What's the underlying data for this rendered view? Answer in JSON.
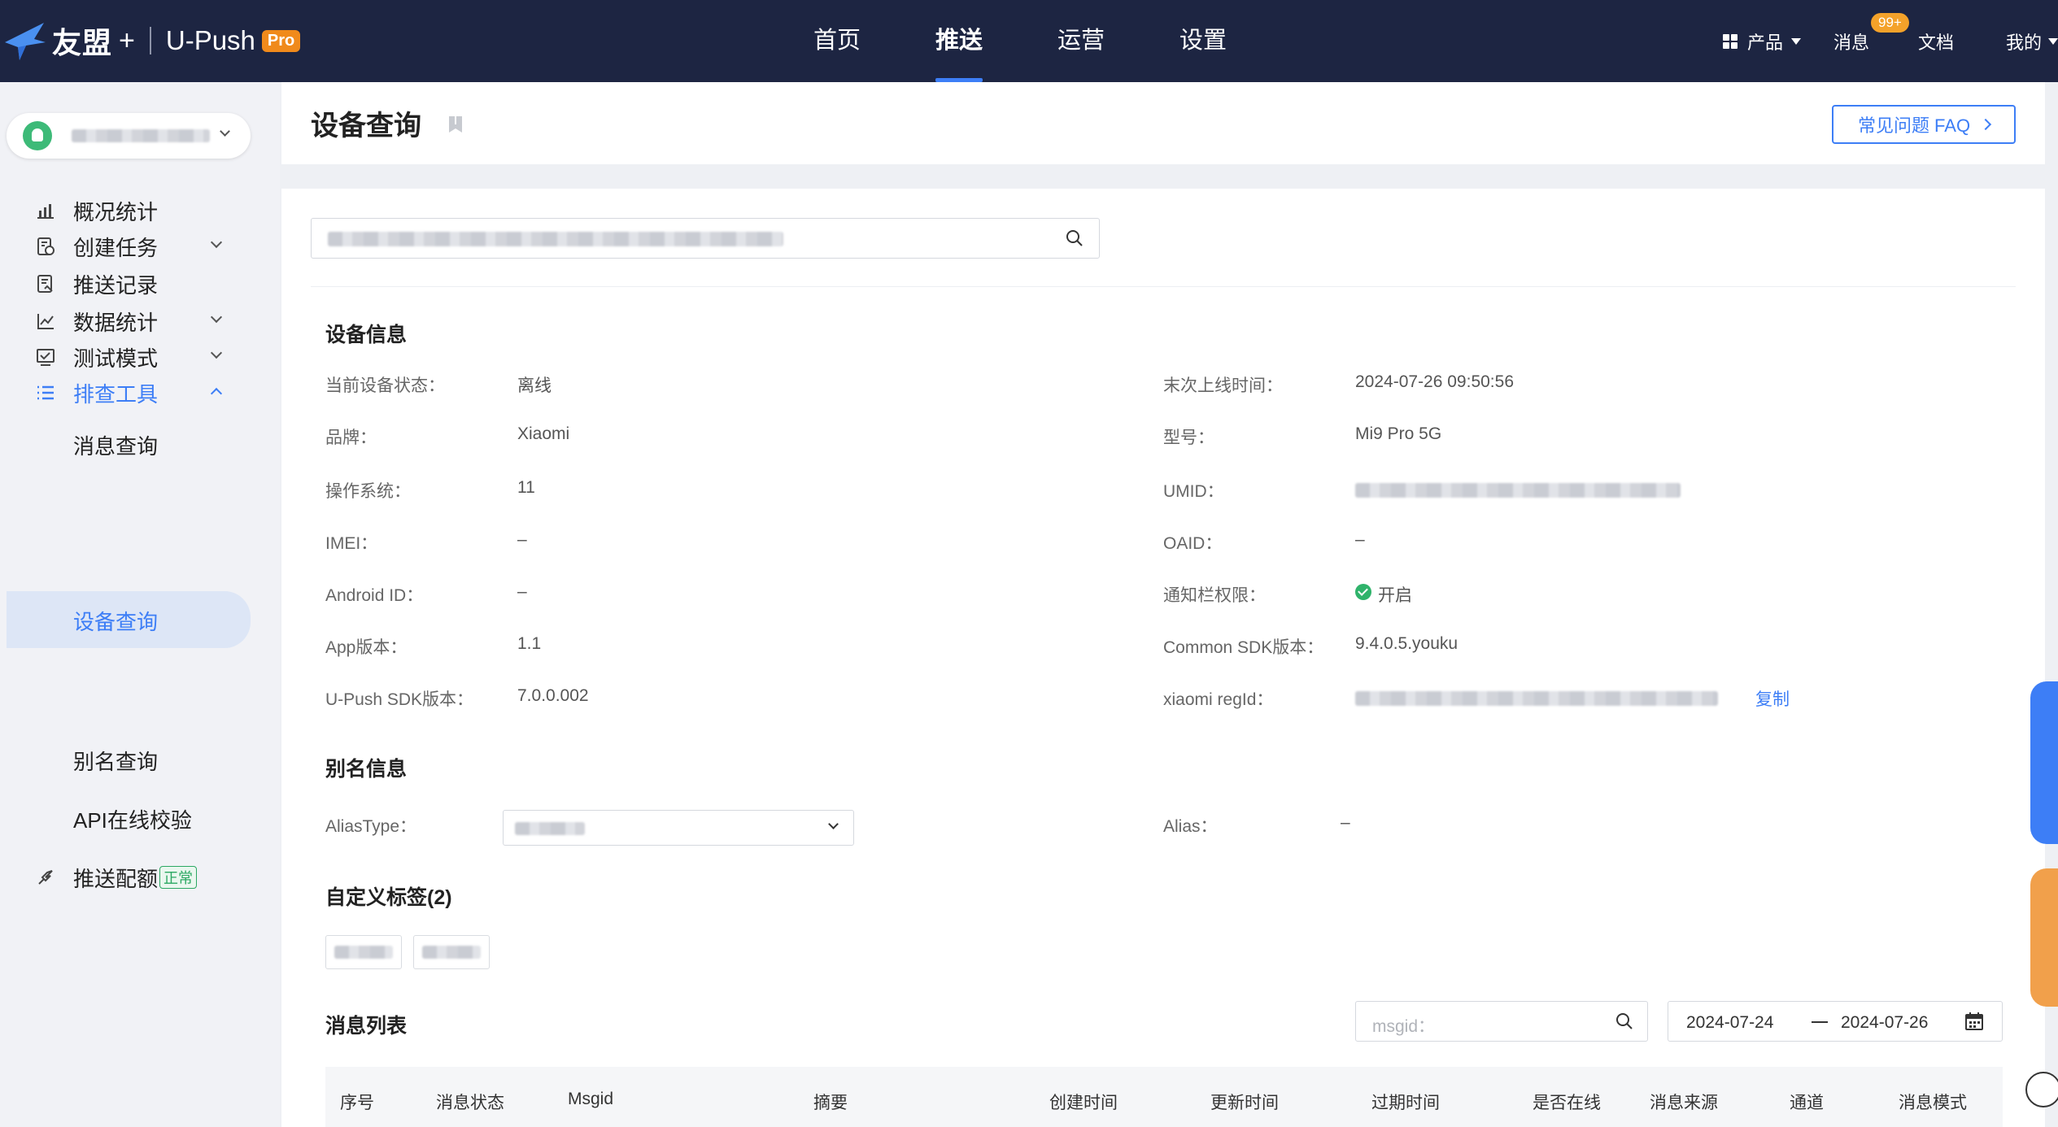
{
  "topbar": {
    "brand": "友盟",
    "brand_plus": "+",
    "product": "U-Push",
    "pro_badge": "Pro",
    "nav": [
      "首页",
      "推送",
      "运营",
      "设置"
    ],
    "active_nav": "推送",
    "products_label": "产品",
    "messages_label": "消息",
    "messages_badge": "99+",
    "docs_label": "文档",
    "mine_label": "我的"
  },
  "sidebar": {
    "menu": [
      {
        "label": "概况统计",
        "icon": "chart-icon"
      },
      {
        "label": "创建任务",
        "icon": "create-task-icon"
      },
      {
        "label": "推送记录",
        "icon": "push-record-icon"
      },
      {
        "label": "数据统计",
        "icon": "line-chart-icon"
      },
      {
        "label": "测试模式",
        "icon": "test-mode-icon"
      },
      {
        "label": "排查工具",
        "icon": "list-icon"
      }
    ],
    "sub_menu": [
      "消息查询",
      "设备查询",
      "别名查询",
      "API在线校验"
    ],
    "active_sub": "设备查询",
    "quota": {
      "label": "推送配额",
      "status": "正常"
    }
  },
  "header": {
    "title": "设备查询",
    "faq_button": "常见问题 FAQ"
  },
  "device_info": {
    "section_title": "设备信息",
    "left": [
      {
        "label": "当前设备状态：",
        "value": "离线"
      },
      {
        "label": "品牌：",
        "value": "Xiaomi"
      },
      {
        "label": "操作系统：",
        "value": "11"
      },
      {
        "label": "IMEI：",
        "value": "–"
      },
      {
        "label": "Android ID：",
        "value": "–"
      },
      {
        "label": "App版本：",
        "value": "1.1"
      },
      {
        "label": "U-Push SDK版本：",
        "value": "7.0.0.002"
      }
    ],
    "right": [
      {
        "label": "末次上线时间：",
        "value": "2024-07-26 09:50:56"
      },
      {
        "label": "型号：",
        "value": "Mi9 Pro 5G"
      },
      {
        "label": "UMID：",
        "value": ""
      },
      {
        "label": "OAID：",
        "value": "–"
      },
      {
        "label": "通知栏权限：",
        "value": "开启"
      },
      {
        "label": "Common SDK版本：",
        "value": "9.4.0.5.youku"
      },
      {
        "label": "xiaomi regId：",
        "value": ""
      }
    ],
    "copy_label": "复制"
  },
  "alias_info": {
    "section_title": "别名信息",
    "alias_type_label": "AliasType：",
    "alias_label": "Alias：",
    "alias_value": "–"
  },
  "custom_tags": {
    "section_title": "自定义标签(2)"
  },
  "message_list": {
    "section_title": "消息列表",
    "msgid_placeholder": "msgid：",
    "date_start": "2024-07-24",
    "date_end": "2024-07-26",
    "columns": [
      "序号",
      "消息状态",
      "Msgid",
      "摘要",
      "创建时间",
      "更新时间",
      "过期时间",
      "是否在线",
      "消息来源",
      "通道",
      "消息模式"
    ]
  },
  "colors": {
    "topbar_bg": "#1d2542",
    "accent": "#3d7ef6",
    "pro_badge": "#f08a1b",
    "online_green": "#2fb36b"
  }
}
